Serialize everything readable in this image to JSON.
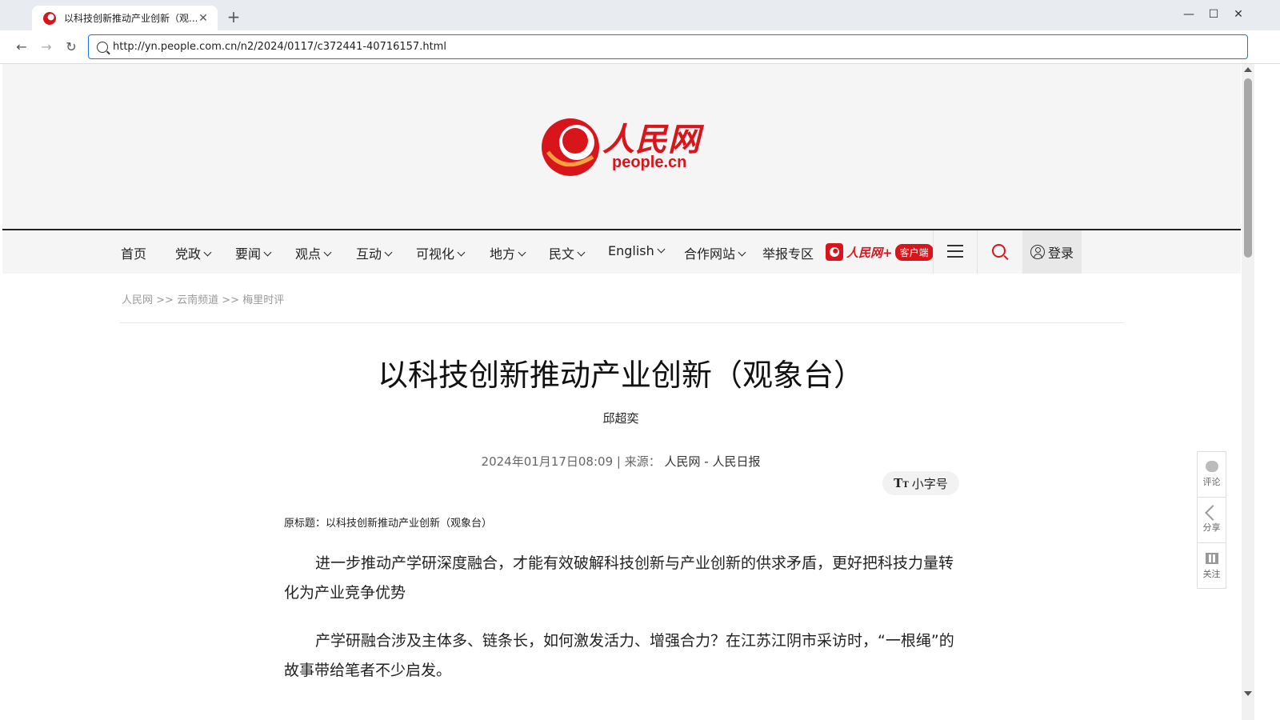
{
  "browser": {
    "tab_title": "以科技创新推动产业创新（观...",
    "url": "http://yn.people.com.cn/n2/2024/0117/c372441-40716157.html"
  },
  "brand": {
    "logo_text": "人民网",
    "logo_sub": "people.cn",
    "accent_color": "#d8151b"
  },
  "nav": {
    "items": [
      {
        "label": "首页",
        "dropdown": false
      },
      {
        "label": "党政",
        "dropdown": true
      },
      {
        "label": "要闻",
        "dropdown": true
      },
      {
        "label": "观点",
        "dropdown": true
      },
      {
        "label": "互动",
        "dropdown": true
      },
      {
        "label": "可视化",
        "dropdown": true
      },
      {
        "label": "地方",
        "dropdown": true
      },
      {
        "label": "民文",
        "dropdown": true
      },
      {
        "label": "English",
        "dropdown": true
      },
      {
        "label": "合作网站",
        "dropdown": true
      },
      {
        "label": "举报专区",
        "dropdown": false
      }
    ],
    "app_name": "人民网+",
    "app_pill": "客户端",
    "login_label": "登录"
  },
  "breadcrumb": {
    "items": [
      "人民网",
      "云南频道",
      "梅里时评"
    ],
    "separator": ">>"
  },
  "article": {
    "title": "以科技创新推动产业创新（观象台）",
    "author": "邱超奕",
    "date": "2024年01月17日08:09",
    "source_label": "来源：",
    "source": "人民网 - 人民日报",
    "font_toggle": "小字号",
    "original_title": "原标题：以科技创新推动产业创新（观象台）",
    "paragraphs": [
      "进一步推动产学研深度融合，才能有效破解科技创新与产业创新的供求矛盾，更好把科技力量转化为产业竞争优势",
      "产学研融合涉及主体多、链条长，如何激发活力、增强合力？在江苏江阴市采访时，“一根绳”的故事带给笔者不少启发。"
    ]
  },
  "side_panel": {
    "comment": "评论",
    "share": "分享",
    "follow": "关注"
  }
}
